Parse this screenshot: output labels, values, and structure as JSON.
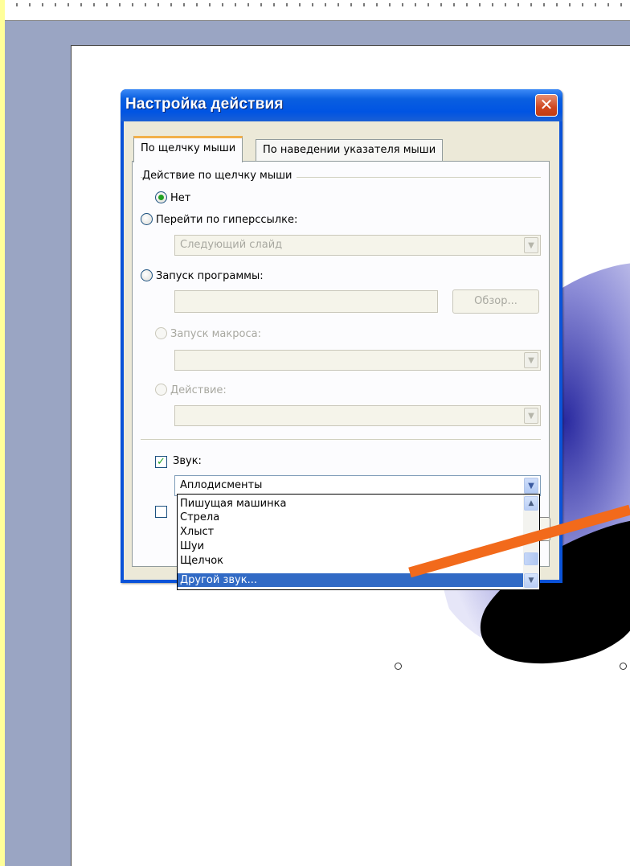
{
  "dialog": {
    "title": "Настройка действия",
    "close_symbol": "✕",
    "tabs": [
      {
        "label": "По щелчку мыши",
        "active": true
      },
      {
        "label": "По наведении указателя мыши",
        "active": false
      }
    ],
    "group_label": "Действие по щелчку мыши",
    "options": {
      "none": "Нет",
      "hyperlink": "Перейти по гиперссылке:",
      "hyperlink_value": "Следующий слайд",
      "run_program": "Запуск программы:",
      "browse": "Обзор...",
      "run_macro": "Запуск макроса:",
      "action": "Действие:"
    },
    "sound": {
      "label": "Звук:",
      "checked": true,
      "selected": "Аплодисменты",
      "list": [
        "Пишущая машинка",
        "Стрела",
        "Хлыст",
        "Шуи",
        "Щелчок",
        "Другой звук..."
      ],
      "highlighted": "Другой звук..."
    }
  },
  "colors": {
    "title_bar": "#0054e3",
    "dialog_bg": "#ece9d8",
    "selection": "#316ac5",
    "arrow": "#f26a1b",
    "slide_bg": "#9aa5c3"
  },
  "icons": {
    "close": "close-icon",
    "dropdown": "chevron-down-icon",
    "scroll_up": "chevron-up-icon",
    "scroll_down": "chevron-down-icon"
  }
}
